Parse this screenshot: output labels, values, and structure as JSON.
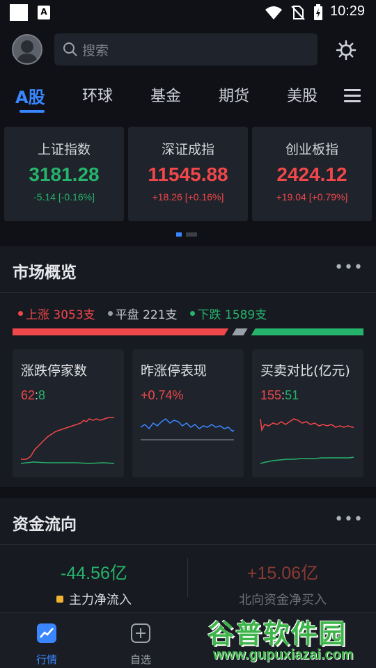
{
  "status_bar": {
    "time": "10:29",
    "badge": "A"
  },
  "header": {
    "search_placeholder": "搜索"
  },
  "market_tabs": [
    "A股",
    "环球",
    "基金",
    "期货",
    "美股"
  ],
  "indices": [
    {
      "name": "上证指数",
      "value": "3181.28",
      "change": "-5.14 [-0.16%]",
      "trend": "down"
    },
    {
      "name": "深证成指",
      "value": "11545.88",
      "change": "+18.26 [+0.16%]",
      "trend": "up"
    },
    {
      "name": "创业板指",
      "value": "2424.12",
      "change": "+19.04 [+0.79%]",
      "trend": "up"
    }
  ],
  "overview": {
    "title": "市场概览",
    "more": "•••",
    "rise": "上涨 3053支",
    "flat": "平盘 221支",
    "fall": "下跌 1589支",
    "rise_count": 3053,
    "flat_count": 221,
    "fall_count": 1589,
    "cards": [
      {
        "title": "涨跌停家数",
        "val_a": "62",
        "sep": ":",
        "val_b": "8"
      },
      {
        "title": "昨涨停表现",
        "value": "+0.74%"
      },
      {
        "title": "买卖对比(亿元)",
        "val_a": "155",
        "sep": ":",
        "val_b": "51"
      }
    ]
  },
  "capital_flow": {
    "title": "资金流向",
    "more": "•••",
    "main_value": "-44.56亿",
    "main_label": "主力净流入",
    "north_value": "+15.06亿",
    "north_label": "北向资金净买入"
  },
  "bottom_nav": [
    {
      "label": "行情",
      "icon": "chart-trend-icon",
      "active": true
    },
    {
      "label": "自选",
      "icon": "plus-square-icon",
      "active": false
    }
  ],
  "watermark": {
    "text": "谷普软件园",
    "url": "www.gupuxiazai.com"
  },
  "colors": {
    "accent": "#3a86ff",
    "up": "#f0474a",
    "down": "#26b36b",
    "flat": "#9aa0a8",
    "background": "#0f1116",
    "card": "#1f232b"
  }
}
